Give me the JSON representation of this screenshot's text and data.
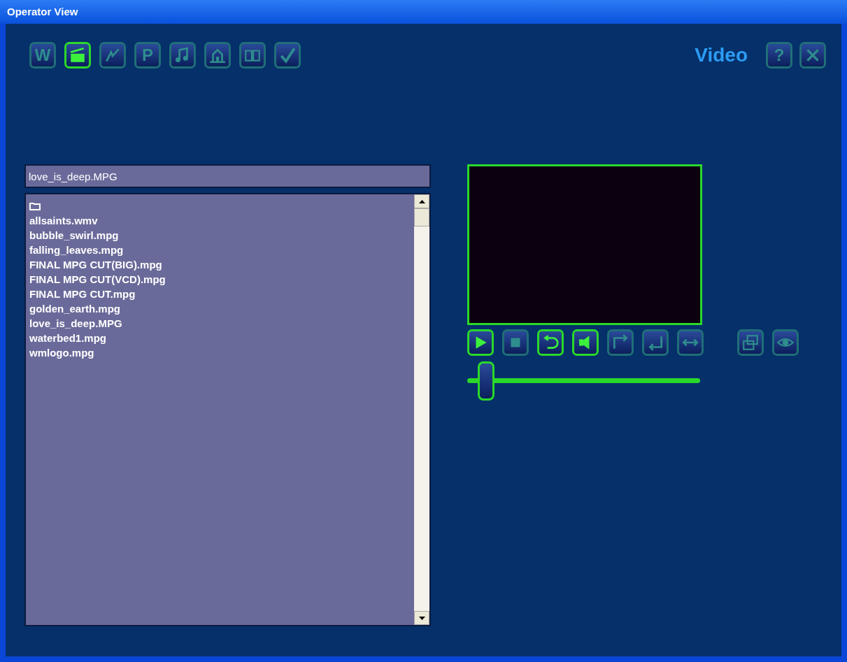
{
  "window": {
    "title": "Operator View"
  },
  "toolbar": [
    {
      "kind": "letter",
      "label": "W",
      "selected": false
    },
    {
      "kind": "clapper",
      "selected": true
    },
    {
      "kind": "lightning",
      "selected": false
    },
    {
      "kind": "letter",
      "label": "P",
      "selected": false
    },
    {
      "kind": "music",
      "selected": false
    },
    {
      "kind": "house",
      "selected": false
    },
    {
      "kind": "book",
      "selected": false
    },
    {
      "kind": "check",
      "selected": false
    }
  ],
  "section_title": "Video",
  "header_buttons": [
    {
      "kind": "letter",
      "label": "?"
    },
    {
      "kind": "close"
    }
  ],
  "file_field": {
    "value": "love_is_deep.MPG"
  },
  "files": [
    {
      "kind": "folder"
    },
    {
      "kind": "file",
      "name": "allsaints.wmv"
    },
    {
      "kind": "file",
      "name": "bubble_swirl.mpg"
    },
    {
      "kind": "file",
      "name": "falling_leaves.mpg"
    },
    {
      "kind": "file",
      "name": "FINAL MPG CUT(BIG).mpg"
    },
    {
      "kind": "file",
      "name": "FINAL MPG CUT(VCD).mpg"
    },
    {
      "kind": "file",
      "name": "FINAL MPG CUT.mpg"
    },
    {
      "kind": "file",
      "name": "golden_earth.mpg"
    },
    {
      "kind": "file",
      "name": "love_is_deep.MPG"
    },
    {
      "kind": "file",
      "name": "waterbed1.mpg"
    },
    {
      "kind": "file",
      "name": "wmlogo.mpg"
    }
  ],
  "media_buttons": [
    {
      "kind": "play",
      "on": true
    },
    {
      "kind": "stop",
      "on": false
    },
    {
      "kind": "loop",
      "on": true
    },
    {
      "kind": "speaker",
      "on": true
    },
    {
      "kind": "arrow-right",
      "on": false
    },
    {
      "kind": "return",
      "on": false
    },
    {
      "kind": "resize",
      "on": false
    }
  ],
  "view_buttons": [
    {
      "kind": "windows",
      "on": false
    },
    {
      "kind": "eye",
      "on": false
    }
  ],
  "seek_slider": {
    "level": 0.08
  }
}
